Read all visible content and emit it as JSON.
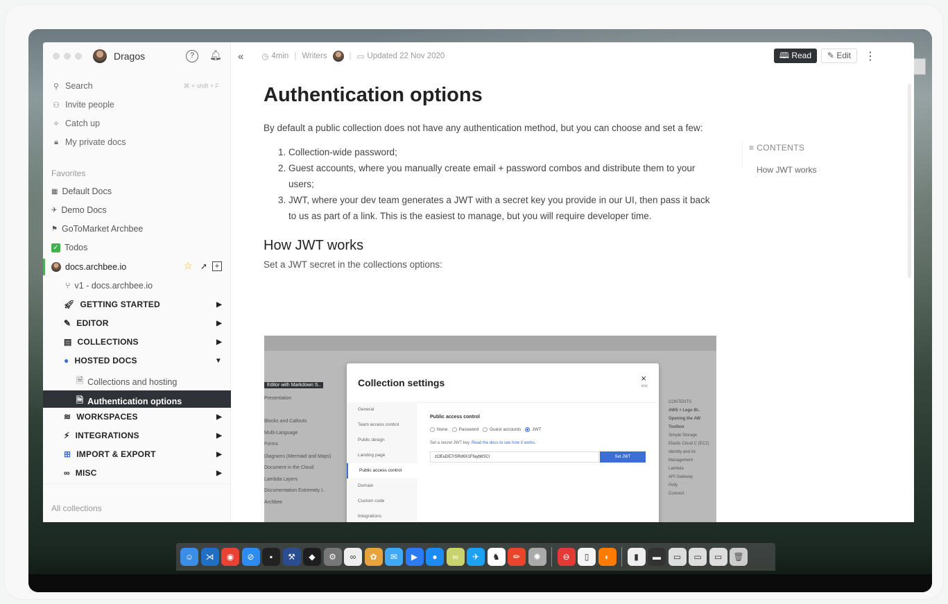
{
  "sidebar": {
    "username": "Dragos",
    "search_label": "Search",
    "search_shortcut": "⌘ + shift + F",
    "invite_label": "Invite people",
    "catchup_label": "Catch up",
    "private_label": "My private docs",
    "favorites_label": "Favorites",
    "favorites": [
      "Default Docs",
      "Demo Docs",
      "GoToMarket Archbee",
      "Todos"
    ],
    "space": "docs.archbee.io",
    "version": "v1 - docs.archbee.io",
    "categories": [
      "GETTING STARTED",
      "EDITOR",
      "COLLECTIONS",
      "HOSTED DOCS",
      "WORKSPACES",
      "INTEGRATIONS",
      "IMPORT & EXPORT",
      "MISC"
    ],
    "pages": [
      "Collections and hosting",
      "Authentication options"
    ],
    "all_collections": "All collections"
  },
  "topbar": {
    "collapse": "«",
    "read_time": "4min",
    "writers_label": "Writers",
    "updated": "Updated 22 Nov 2020",
    "read_label": "Read",
    "edit_label": "Edit"
  },
  "doc": {
    "title": "Authentication options",
    "intro": "By default a public collection does not have any authentication method, but you can choose and set a few:",
    "list": [
      "Collection-wide password;",
      "Guest accounts, where you manually create email + password combos and distribute them to your users;",
      "JWT, where your dev team generates a JWT with a secret key you provide in our UI, then pass it back to us as part of a link. This is the easiest to manage, but you will require developer time."
    ],
    "h2": "How JWT works",
    "p2": "Set a JWT secret in the collections options:"
  },
  "toc": {
    "header": "CONTENTS",
    "items": [
      "How JWT works"
    ]
  },
  "screenshot": {
    "modal_title": "Collection settings",
    "close": "×",
    "esc": "esc",
    "nav": [
      "General",
      "Team access control",
      "Public design",
      "Landing page",
      "Public access control",
      "Domain",
      "Custom code",
      "Integrations"
    ],
    "section": "Public access control",
    "options": [
      "None",
      "Password",
      "Guest accounts",
      "JWT"
    ],
    "hint_prefix": "Set a secret JWT key.",
    "hint_link": "Read the docs to see how it works.",
    "jwt_value": "zOEuDE7rSRd6X1Ffayb8SCl",
    "button": "Set JWT",
    "side_left": [
      "Editor with Markdown S..",
      "Presentation",
      "Blocks and Callouts",
      "Multi-Language",
      "Forms",
      "Diagrams (Mermaid and Maps)",
      "Document in the Cloud",
      "Lambda Layers",
      "Documentation Extremely I..",
      "Archbee"
    ],
    "side_right": [
      "CONTENTS",
      "AWS + Lego Bl..",
      "Opening the AW Toolbox",
      "Simple Storage",
      "Elastic Cloud C (EC2)",
      "Identity and Ac Management",
      "Lambda",
      "API Gateway",
      "Polly",
      "Connect"
    ]
  },
  "colors": {
    "accent": "#2f3237",
    "link": "#3b6fd4",
    "favorite_star": "#f5b400"
  }
}
